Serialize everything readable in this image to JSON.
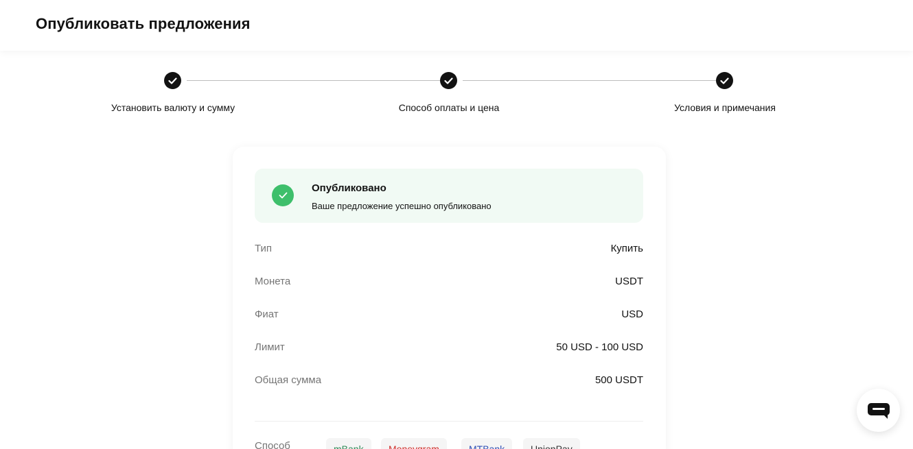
{
  "header": {
    "title": "Опубликовать предложения"
  },
  "steps": [
    {
      "label": "Установить валюту и сумму",
      "icon": "check-icon"
    },
    {
      "label": "Способ оплаты и цена",
      "icon": "check-icon"
    },
    {
      "label": "Условия и примечания",
      "icon": "check-icon"
    }
  ],
  "success": {
    "title": "Опубликовано",
    "text": "Ваше предложение успешно опубликовано",
    "icon": "check-circle-icon",
    "color": "#3ebf6b"
  },
  "details": [
    {
      "label": "Тип",
      "value": "Купить"
    },
    {
      "label": "Монета",
      "value": "USDT"
    },
    {
      "label": "Фиат",
      "value": "USD"
    },
    {
      "label": "Лимит",
      "value": "50 USD - 100 USD"
    },
    {
      "label": "Общая сумма",
      "value": "500 USDT"
    }
  ],
  "payment": {
    "label": "Способ",
    "methods": [
      {
        "name": "mBank",
        "color": "#2e8b57"
      },
      {
        "name": "Moneygram",
        "color": "#d0322d"
      },
      {
        "name": "MTBank",
        "color": "#2f4fb5"
      },
      {
        "name": "UnionPay",
        "color": "#333333"
      }
    ]
  },
  "chat": {
    "icon": "chat-icon"
  }
}
